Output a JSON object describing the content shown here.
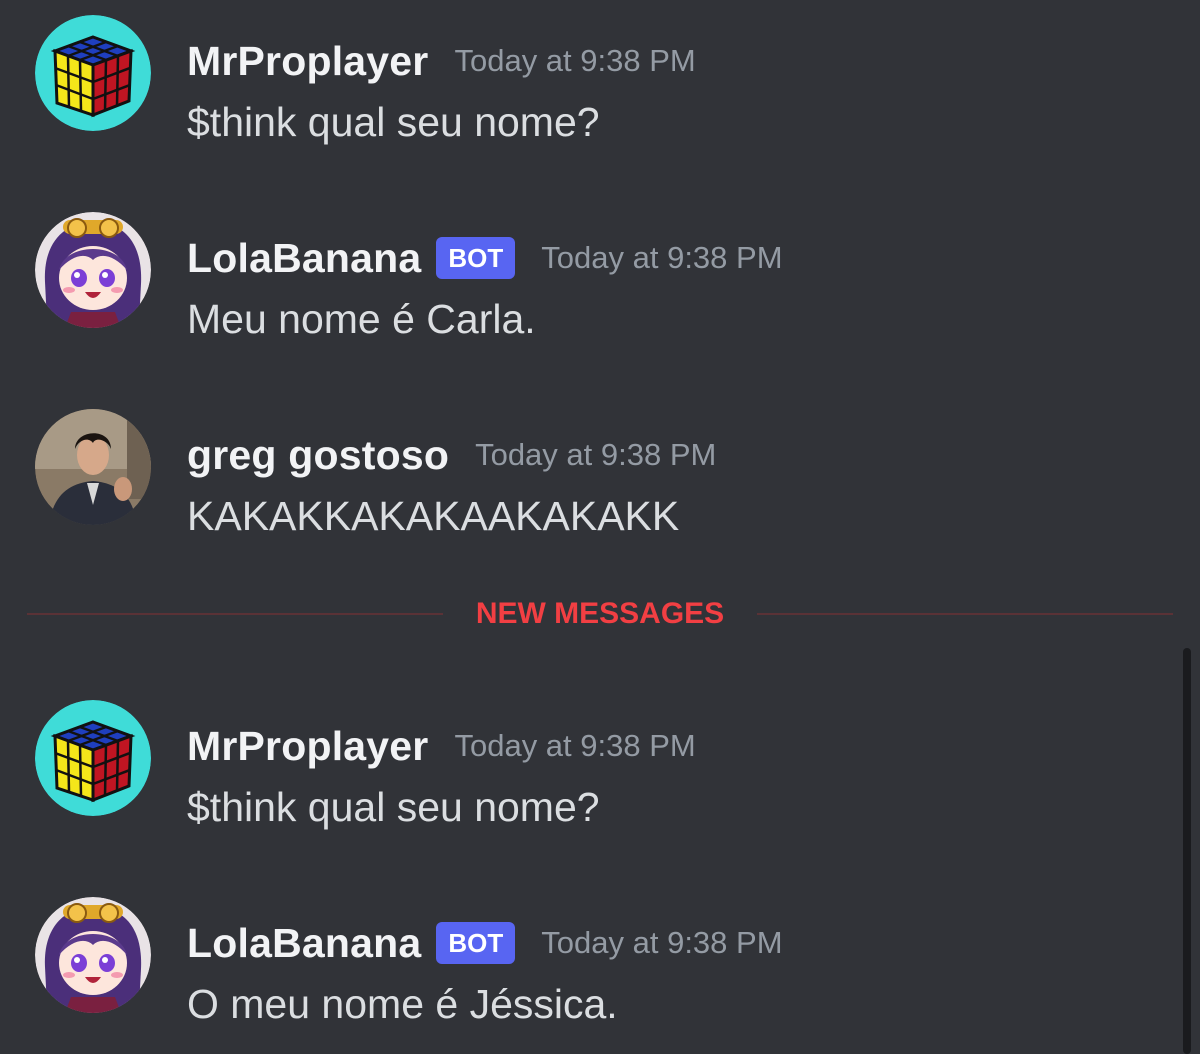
{
  "messages": [
    {
      "author": "MrProplayer",
      "is_bot": false,
      "timestamp": "Today at 9:38 PM",
      "content": "$think qual seu nome?",
      "avatar": "rubiks-cube-avatar"
    },
    {
      "author": "LolaBanana",
      "is_bot": true,
      "bot_tag": "BOT",
      "timestamp": "Today at 9:38 PM",
      "content": "Meu nome é Carla.",
      "avatar": "anime-girl-avatar"
    },
    {
      "author": "greg gostoso",
      "is_bot": false,
      "timestamp": "Today at 9:38 PM",
      "content": "KAKAKKAKAKAAKAKAKK",
      "avatar": "person-photo-avatar"
    },
    {
      "author": "MrProplayer",
      "is_bot": false,
      "timestamp": "Today at 9:38 PM",
      "content": "$think qual seu nome?",
      "avatar": "rubiks-cube-avatar"
    },
    {
      "author": "LolaBanana",
      "is_bot": true,
      "bot_tag": "BOT",
      "timestamp": "Today at 9:38 PM",
      "content": "O meu nome é Jéssica.",
      "avatar": "anime-girl-avatar"
    }
  ],
  "divider": {
    "label": "NEW MESSAGES"
  },
  "colors": {
    "background": "#313338",
    "username": "#f2f3f5",
    "timestamp": "#949ba4",
    "content": "#dbdee1",
    "bot_tag": "#5865f2",
    "new_messages": "#f23f43"
  }
}
